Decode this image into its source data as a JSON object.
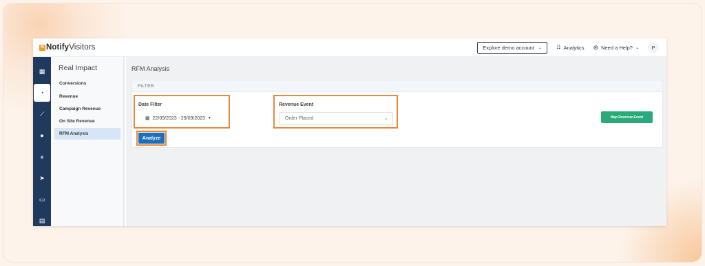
{
  "brand": {
    "logo_mark": "N",
    "name_bold": "Notify",
    "name_rest": "Visitors"
  },
  "topbar": {
    "explore_label": "Explore demo account",
    "analytics_label": "Analytics",
    "help_label": "Need a Help?",
    "avatar_initial": "P"
  },
  "rail": {
    "items": [
      {
        "icon": "grid-icon",
        "glyph": "▦"
      },
      {
        "icon": "dashboard-icon",
        "glyph": "◔"
      },
      {
        "icon": "chart-icon",
        "glyph": "⟋"
      },
      {
        "icon": "users-icon",
        "glyph": "●"
      },
      {
        "icon": "hierarchy-icon",
        "glyph": "⚹"
      },
      {
        "icon": "send-icon",
        "glyph": "➤"
      },
      {
        "icon": "card-icon",
        "glyph": "▭"
      },
      {
        "icon": "document-icon",
        "glyph": "▤"
      }
    ]
  },
  "subnav": {
    "title": "Real Impact",
    "items": [
      {
        "label": "Conversions"
      },
      {
        "label": "Revenue"
      },
      {
        "label": "Campaign Revenue"
      },
      {
        "label": "On Site Revenue"
      },
      {
        "label": "RFM Analysis"
      }
    ]
  },
  "main": {
    "page_title": "RFM Analysis",
    "filter_header": "FILTER",
    "date_filter_label": "Date Filter",
    "date_range": "22/09/2023 - 29/09/2023",
    "revenue_event_label": "Revenue Event",
    "revenue_event_value": "Order Placed",
    "analyze_label": "Analyze",
    "map_button_label": "Map Revenue Event"
  },
  "colors": {
    "rail": "#1f3a5c",
    "highlight": "#e8883a",
    "primary": "#1f6fb8",
    "success": "#2aaa7a"
  }
}
